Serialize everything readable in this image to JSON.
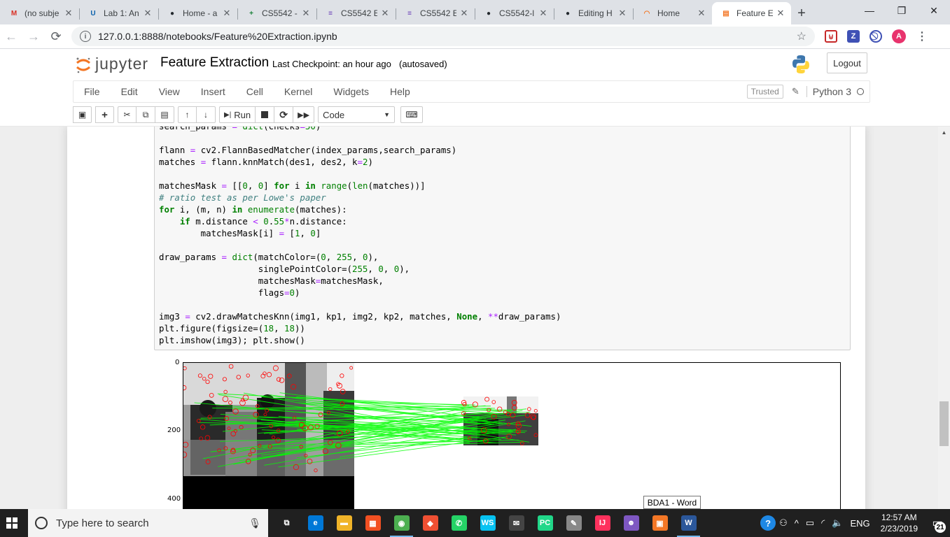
{
  "browser": {
    "tabs": [
      {
        "title": "(no subje",
        "icon": "gmail-icon",
        "color": "#d93025",
        "glyph": "M"
      },
      {
        "title": "Lab 1: An",
        "icon": "umkc-icon",
        "color": "#0b62ad",
        "glyph": "U"
      },
      {
        "title": "Home - a",
        "icon": "github-icon",
        "color": "#24292e",
        "glyph": "●"
      },
      {
        "title": "CS5542 -",
        "icon": "sheets-icon",
        "color": "#188038",
        "glyph": "+"
      },
      {
        "title": "CS5542 E",
        "icon": "forms-icon",
        "color": "#673ab7",
        "glyph": "≡"
      },
      {
        "title": "CS5542 E",
        "icon": "forms-icon",
        "color": "#673ab7",
        "glyph": "≡"
      },
      {
        "title": "CS5542-l",
        "icon": "github-icon",
        "color": "#24292e",
        "glyph": "●"
      },
      {
        "title": "Editing H",
        "icon": "github-icon",
        "color": "#24292e",
        "glyph": "●"
      },
      {
        "title": "Home",
        "icon": "jupyter-icon",
        "color": "#f37726",
        "glyph": "◠"
      },
      {
        "title": "Feature E",
        "icon": "notebook-icon",
        "color": "#f37726",
        "glyph": "▤",
        "active": true
      }
    ],
    "url": "127.0.0.1:8888/notebooks/Feature%20Extraction.ipynb",
    "profile_initial": "A"
  },
  "jupyter": {
    "logo_text": "jupyter",
    "notebook_title": "Feature Extraction",
    "checkpoint": "Last Checkpoint: an hour ago",
    "autosave": "(autosaved)",
    "logout_label": "Logout",
    "menu": [
      "File",
      "Edit",
      "View",
      "Insert",
      "Cell",
      "Kernel",
      "Widgets",
      "Help"
    ],
    "trusted_label": "Trusted",
    "kernel_name": "Python 3",
    "run_label": "Run",
    "cell_type": "Code"
  },
  "code_lines": [
    "search_params = dict(checks=50)",
    "",
    "flann = cv2.FlannBasedMatcher(index_params,search_params)",
    "matches = flann.knnMatch(des1, des2, k=2)",
    "",
    "matchesMask = [[0, 0] for i in range(len(matches))]",
    "# ratio test as per Lowe's paper",
    "for i, (m, n) in enumerate(matches):",
    "    if m.distance < 0.55*n.distance:",
    "        matchesMask[i] = [1, 0]",
    "",
    "draw_params = dict(matchColor=(0, 255, 0),",
    "                   singlePointColor=(255, 0, 0),",
    "                   matchesMask=matchesMask,",
    "                   flags=0)",
    "",
    "img3 = cv2.drawMatchesKnn(img1, kp1, img2, kp2, matches, None, **draw_params)",
    "plt.figure(figsize=(18, 18))",
    "plt.imshow(img3); plt.show()"
  ],
  "plot": {
    "yticks": [
      "0",
      "200",
      "400"
    ]
  },
  "tooltip": "BDA1 - Word",
  "taskbar": {
    "search_placeholder": "Type here to search",
    "language": "ENG",
    "time": "12:57 AM",
    "date": "2/23/2019",
    "notifications": "21",
    "apps": [
      {
        "name": "task-view-icon",
        "color": "#202020",
        "glyph": "⧉"
      },
      {
        "name": "edge-icon",
        "color": "#0078d7",
        "glyph": "e"
      },
      {
        "name": "file-explorer-icon",
        "color": "#f0b429",
        "glyph": "▬"
      },
      {
        "name": "store-icon",
        "color": "#f25022",
        "glyph": "▦"
      },
      {
        "name": "chrome-icon",
        "color": "#4caf50",
        "glyph": "◉",
        "running": true
      },
      {
        "name": "git-icon",
        "color": "#f05033",
        "glyph": "◆"
      },
      {
        "name": "whatsapp-icon",
        "color": "#25d366",
        "glyph": "✆"
      },
      {
        "name": "webstorm-icon",
        "color": "#07c3f2",
        "glyph": "WS"
      },
      {
        "name": "mail-icon",
        "color": "#444444",
        "glyph": "✉"
      },
      {
        "name": "pycharm-icon",
        "color": "#21d789",
        "glyph": "PC"
      },
      {
        "name": "paint-icon",
        "color": "#888888",
        "glyph": "✎"
      },
      {
        "name": "intellij-icon",
        "color": "#fe315d",
        "glyph": "IJ"
      },
      {
        "name": "cat-app-icon",
        "color": "#7e57c2",
        "glyph": "☻"
      },
      {
        "name": "presenter-icon",
        "color": "#f37726",
        "glyph": "▣"
      },
      {
        "name": "word-icon",
        "color": "#2b579a",
        "glyph": "W",
        "running": true
      }
    ]
  }
}
